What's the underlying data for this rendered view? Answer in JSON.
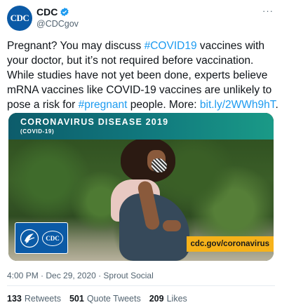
{
  "account": {
    "avatar_text": "CDC",
    "display_name": "CDC",
    "handle": "@CDCgov",
    "more_label": "···"
  },
  "tweet": {
    "text_before_hashtag1": "Pregnant? You may discuss ",
    "hashtag1": "#COVID19",
    "text_mid1": " vaccines with your doctor, but it’s not required before vaccination. While studies have not yet been done, experts believe mRNA vaccines like COVID-19 vaccines are unlikely to pose a risk for ",
    "hashtag2": "#pregnant",
    "text_mid2": " people. More: ",
    "link": "bit.ly/2WWh9hT",
    "text_end": "."
  },
  "media": {
    "banner_title": "CORONAVIRUS DISEASE 2019",
    "banner_subtitle": "(COVID-19)",
    "logo_text": "CDC",
    "url_tag": "cdc.gov/coronavirus"
  },
  "meta": {
    "timestamp": "4:00 PM · Dec 29, 2020 · Sprout Social"
  },
  "stats": {
    "retweets_count": "133",
    "retweets_label": "Retweets",
    "quote_count": "501",
    "quote_label": "Quote Tweets",
    "likes_count": "209",
    "likes_label": "Likes"
  },
  "colors": {
    "link": "#1d9bf0",
    "cdc_blue": "#0b5aa6",
    "banner_teal": "#117a7e",
    "url_tag_bg": "#f6b21a"
  }
}
